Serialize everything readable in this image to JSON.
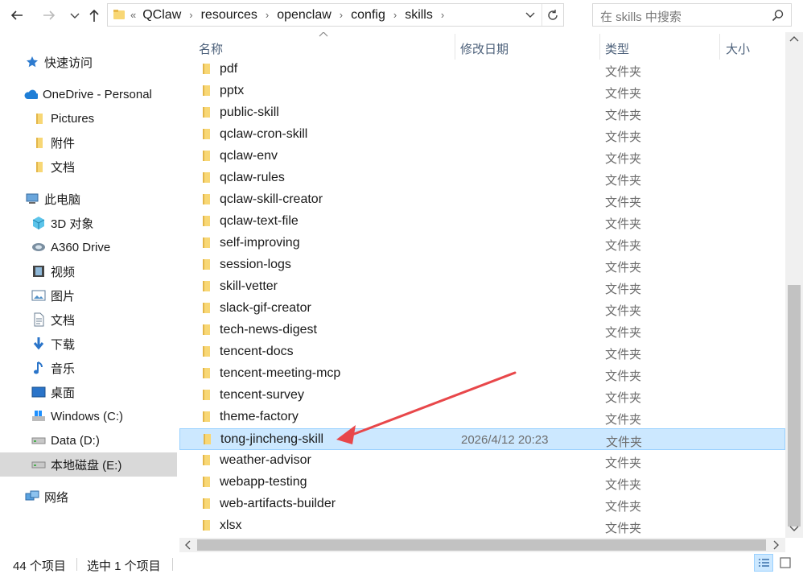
{
  "toolbar": {
    "back_icon": "arrow-left-icon",
    "forward_icon": "arrow-right-icon",
    "recent_icon": "chevron-down-icon",
    "up_icon": "arrow-up-icon"
  },
  "address_bar": {
    "overflow": "«",
    "crumbs": [
      "QClaw",
      "resources",
      "openclaw",
      "config",
      "skills"
    ],
    "separator": "›"
  },
  "search": {
    "placeholder": "在 skills 中搜索"
  },
  "nav": {
    "items": [
      {
        "label": "快速访问",
        "icon": "star-icon"
      },
      {
        "label": "OneDrive - Personal",
        "icon": "cloud-icon"
      },
      {
        "label": "Pictures",
        "icon": "folder-icon"
      },
      {
        "label": "附件",
        "icon": "folder-icon"
      },
      {
        "label": "文档",
        "icon": "folder-icon"
      },
      {
        "label": "此电脑",
        "icon": "computer-icon"
      },
      {
        "label": "3D 对象",
        "icon": "cube-icon"
      },
      {
        "label": "A360 Drive",
        "icon": "a360-drive-icon"
      },
      {
        "label": "视频",
        "icon": "video-icon"
      },
      {
        "label": "图片",
        "icon": "picture-icon"
      },
      {
        "label": "文档",
        "icon": "document-icon"
      },
      {
        "label": "下载",
        "icon": "download-icon"
      },
      {
        "label": "音乐",
        "icon": "music-icon"
      },
      {
        "label": "桌面",
        "icon": "desktop-icon"
      },
      {
        "label": "Windows (C:)",
        "icon": "windows-drive-icon"
      },
      {
        "label": "Data (D:)",
        "icon": "drive-icon"
      },
      {
        "label": "本地磁盘 (E:)",
        "icon": "drive-icon"
      },
      {
        "label": "网络",
        "icon": "network-icon"
      }
    ]
  },
  "columns": {
    "name": "名称",
    "modified": "修改日期",
    "type": "类型",
    "size": "大小"
  },
  "files": [
    {
      "name": "pdf",
      "date": "",
      "type": "文件夹"
    },
    {
      "name": "pptx",
      "date": "",
      "type": "文件夹"
    },
    {
      "name": "public-skill",
      "date": "",
      "type": "文件夹"
    },
    {
      "name": "qclaw-cron-skill",
      "date": "",
      "type": "文件夹"
    },
    {
      "name": "qclaw-env",
      "date": "",
      "type": "文件夹"
    },
    {
      "name": "qclaw-rules",
      "date": "",
      "type": "文件夹"
    },
    {
      "name": "qclaw-skill-creator",
      "date": "",
      "type": "文件夹"
    },
    {
      "name": "qclaw-text-file",
      "date": "",
      "type": "文件夹"
    },
    {
      "name": "self-improving",
      "date": "",
      "type": "文件夹"
    },
    {
      "name": "session-logs",
      "date": "",
      "type": "文件夹"
    },
    {
      "name": "skill-vetter",
      "date": "",
      "type": "文件夹"
    },
    {
      "name": "slack-gif-creator",
      "date": "",
      "type": "文件夹"
    },
    {
      "name": "tech-news-digest",
      "date": "",
      "type": "文件夹"
    },
    {
      "name": "tencent-docs",
      "date": "",
      "type": "文件夹"
    },
    {
      "name": "tencent-meeting-mcp",
      "date": "",
      "type": "文件夹"
    },
    {
      "name": "tencent-survey",
      "date": "",
      "type": "文件夹"
    },
    {
      "name": "theme-factory",
      "date": "",
      "type": "文件夹"
    },
    {
      "name": "tong-jincheng-skill",
      "date": "2026/4/12 20:23",
      "type": "文件夹",
      "selected": true
    },
    {
      "name": "weather-advisor",
      "date": "",
      "type": "文件夹"
    },
    {
      "name": "webapp-testing",
      "date": "",
      "type": "文件夹"
    },
    {
      "name": "web-artifacts-builder",
      "date": "",
      "type": "文件夹"
    },
    {
      "name": "xlsx",
      "date": "",
      "type": "文件夹"
    }
  ],
  "status": {
    "count": "44 个项目",
    "selected": "选中 1 个项目"
  },
  "colors": {
    "selection_bg": "#cce8ff",
    "selection_border": "#99d1ff",
    "folder_yellow": "#f8d775",
    "annotation_arrow": "#e8474a",
    "nav_selected": "#d9d9d9"
  }
}
